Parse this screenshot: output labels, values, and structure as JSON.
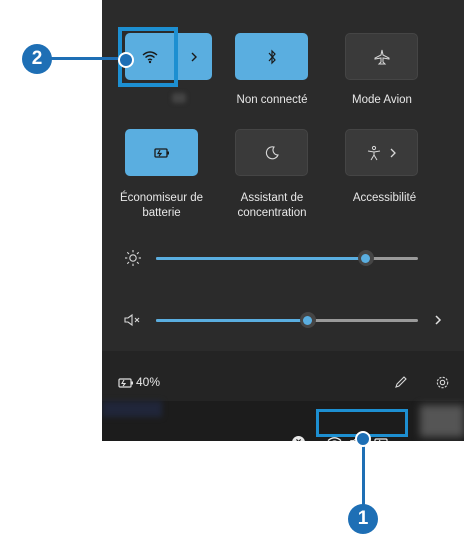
{
  "tiles": [
    {
      "id": "wifi",
      "label": "",
      "icon": "wifi-icon",
      "active": true
    },
    {
      "id": "bluetooth",
      "label": "Non connecté",
      "icon": "bluetooth-icon",
      "active": true
    },
    {
      "id": "airplane",
      "label": "Mode Avion",
      "icon": "airplane-icon",
      "active": false
    },
    {
      "id": "battery-saver",
      "label_line1": "Économiseur de",
      "label_line2": "batterie",
      "icon": "battery-saver-icon",
      "active": true
    },
    {
      "id": "focus",
      "label_line1": "Assistant de",
      "label_line2": "concentration",
      "icon": "moon-icon",
      "active": false
    },
    {
      "id": "accessibility",
      "label": "Accessibilité",
      "icon": "accessibility-icon",
      "active": false
    }
  ],
  "brightness": {
    "icon": "sun-icon",
    "level_percent": 80
  },
  "volume": {
    "icon": "speaker-muted-icon",
    "level_percent": 58
  },
  "footer": {
    "battery_text": "40%",
    "edit_icon": "pencil-icon",
    "settings_icon": "gear-icon"
  },
  "taskbar": {
    "icons": [
      "chevron-up-icon",
      "close-circle-icon",
      "wifi-icon",
      "speaker-muted-icon",
      "battery-icon"
    ]
  },
  "callouts": {
    "one": "1",
    "two": "2"
  },
  "colors": {
    "accent": "#5aaee0",
    "callout": "#1e6fb5",
    "panel": "#2b2b2b"
  }
}
